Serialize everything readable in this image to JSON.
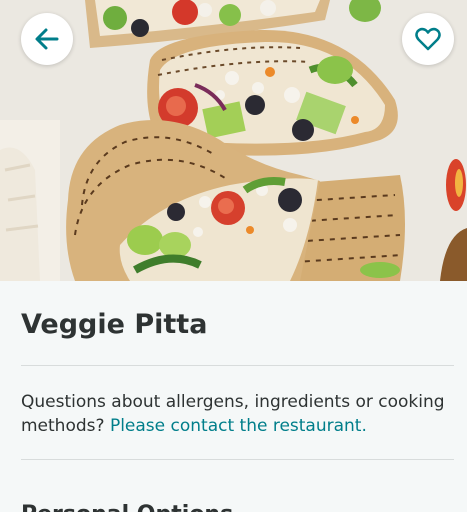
{
  "product": {
    "name": "Veggie Pitta",
    "image_alt": "Veggie pitta pockets filled with salad"
  },
  "info": {
    "question": "Questions about allergens, ingredients or cooking methods?",
    "contact_link": "Please contact the restaurant."
  },
  "section": {
    "heading": "Personal Options"
  },
  "icons": {
    "back": "arrow-left-icon",
    "favourite": "heart-icon"
  },
  "colors": {
    "accent": "#00ccbc",
    "link": "#007e8a",
    "text": "#2e3333",
    "background": "#f5f8f8"
  }
}
